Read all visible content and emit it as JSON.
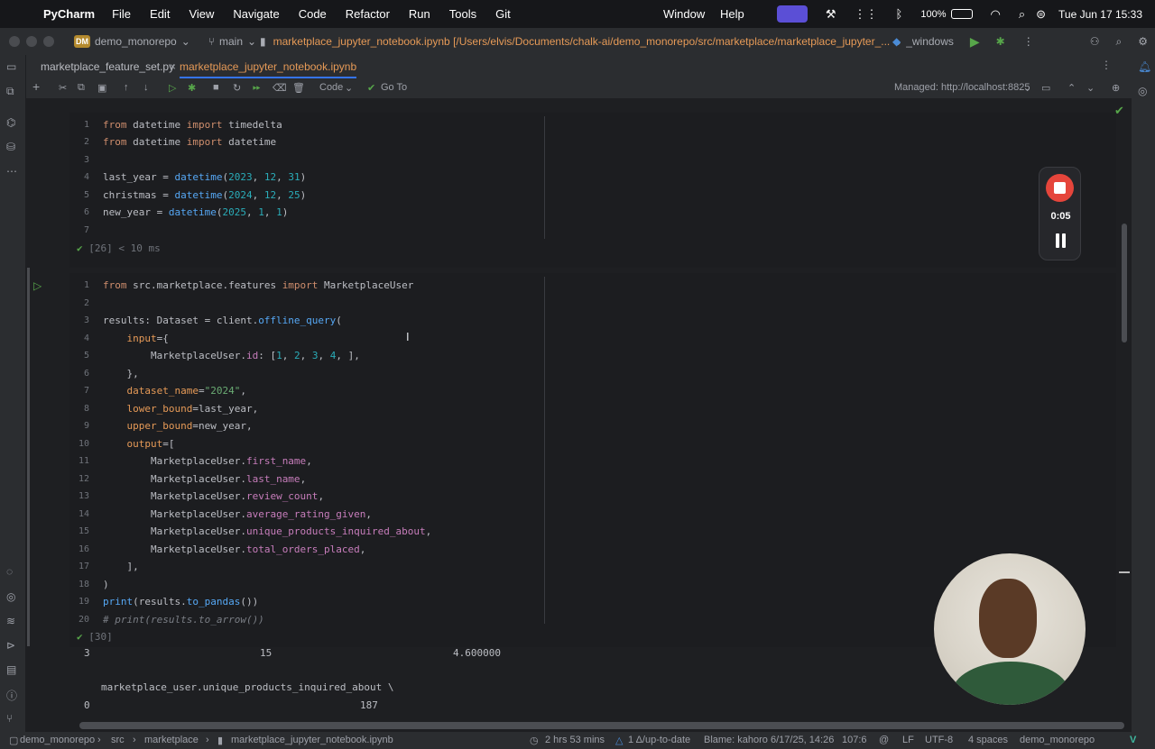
{
  "menubar": {
    "app": "PyCharm",
    "items": [
      "File",
      "Edit",
      "View",
      "Navigate",
      "Code",
      "Refactor",
      "Run",
      "Tools",
      "Git"
    ],
    "right_items": [
      "Window",
      "Help"
    ],
    "battery": "100%",
    "datetime": "Tue Jun 17  15:33"
  },
  "titlebar": {
    "project_badge": "DM",
    "project": "demo_monorepo",
    "branch": "main",
    "file_path": "marketplace_jupyter_notebook.ipynb [/Users/elvis/Documents/chalk-ai/demo_monorepo/src/marketplace/marketplace_jupyter_...",
    "interpreter": "_windows"
  },
  "tabs": [
    {
      "label": "marketplace_feature_set.py"
    },
    {
      "label": "marketplace_jupyter_notebook.ipynb"
    }
  ],
  "toolbar": {
    "cell_type": "Code",
    "goto": "Go To",
    "server": "Managed: http://localhost:8825"
  },
  "cell1": {
    "lines": [
      "from datetime import timedelta",
      "from datetime import datetime",
      "",
      "last_year = datetime(2023, 12, 31)",
      "christmas = datetime(2024, 12, 25)",
      "new_year = datetime(2025, 1, 1)",
      ""
    ],
    "exec": "[26] < 10 ms"
  },
  "cell2": {
    "lines": [
      "from src.marketplace.features import MarketplaceUser",
      "",
      "results: Dataset = client.offline_query(",
      "    input={",
      "        MarketplaceUser.id: [1, 2, 3, 4, ],",
      "    },",
      "    dataset_name=\"2024\",",
      "    lower_bound=last_year,",
      "    upper_bound=new_year,",
      "    output=[",
      "        MarketplaceUser.first_name,",
      "        MarketplaceUser.last_name,",
      "        MarketplaceUser.review_count,",
      "        MarketplaceUser.average_rating_given,",
      "        MarketplaceUser.unique_products_inquired_about,",
      "        MarketplaceUser.total_orders_placed,",
      "    ],",
      ")",
      "print(results.to_pandas())",
      "# print(results.to_arrow())"
    ],
    "exec": "[30]"
  },
  "output": {
    "row3_a": "3",
    "row3_b": "15",
    "row3_c": "4.600000",
    "header": "marketplace_user.unique_products_inquired_about  \\",
    "row0_idx": "0",
    "row0_val": "187"
  },
  "recorder": {
    "time": "0:05"
  },
  "statusbar": {
    "crumbs": [
      "demo_monorepo",
      "src",
      "marketplace",
      "marketplace_jupyter_notebook.ipynb"
    ],
    "time": "2 hrs 53 mins",
    "vcs": "1 Δ/up-to-date",
    "blame": "Blame: kahoro 6/17/25, 14:26",
    "position": "107:6",
    "line_sep": "LF",
    "encoding": "UTF-8",
    "indent": "4 spaces",
    "project": "demo_monorepo"
  }
}
